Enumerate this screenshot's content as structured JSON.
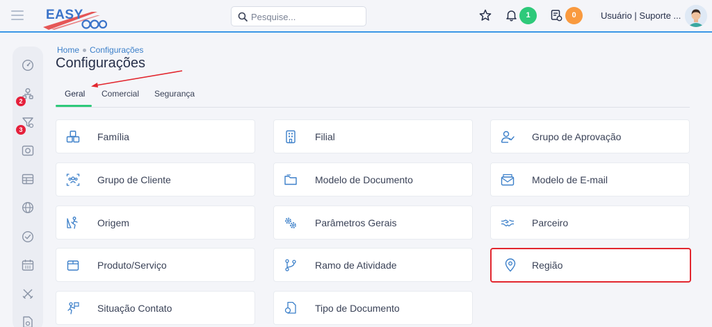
{
  "header": {
    "logo_text": "EASY",
    "search_placeholder": "Pesquise...",
    "notifications_count": "1",
    "tasks_count": "0",
    "user_label": "Usuário | Suporte ..."
  },
  "sidebar": {
    "badges": [
      "2",
      "3"
    ]
  },
  "breadcrumb": {
    "home": "Home",
    "current": "Configurações"
  },
  "page_title": "Configurações",
  "tabs": [
    {
      "label": "Geral"
    },
    {
      "label": "Comercial"
    },
    {
      "label": "Segurança"
    }
  ],
  "cards": {
    "c1_1": {
      "label": "Família",
      "icon": "boxes-icon"
    },
    "c1_2": {
      "label": "Filial",
      "icon": "building-icon"
    },
    "c1_3": {
      "label": "Grupo de Aprovação",
      "icon": "user-check-icon"
    },
    "c2_1": {
      "label": "Grupo de Cliente",
      "icon": "users-group-icon"
    },
    "c2_2": {
      "label": "Modelo de Documento",
      "icon": "folder-icon"
    },
    "c2_3": {
      "label": "Modelo de E-mail",
      "icon": "mail-icon"
    },
    "c3_1": {
      "label": "Origem",
      "icon": "origin-icon"
    },
    "c3_2": {
      "label": "Parâmetros Gerais",
      "icon": "gears-icon"
    },
    "c3_3": {
      "label": "Parceiro",
      "icon": "handshake-icon"
    },
    "c4_1": {
      "label": "Produto/Serviço",
      "icon": "box-icon"
    },
    "c4_2": {
      "label": "Ramo de Atividade",
      "icon": "branch-icon"
    },
    "c4_3": {
      "label": "Região",
      "icon": "map-pin-icon"
    },
    "c5_1": {
      "label": "Situação Contato",
      "icon": "contact-status-icon"
    },
    "c5_2": {
      "label": "Tipo de Documento",
      "icon": "document-type-icon"
    }
  },
  "colors": {
    "accent": "#3b7fc9",
    "tab_underline": "#2ec97a",
    "badge_green": "#2ec97a",
    "badge_orange": "#f99a3f",
    "badge_red": "#e5203b",
    "highlight_border": "#e2262e"
  }
}
